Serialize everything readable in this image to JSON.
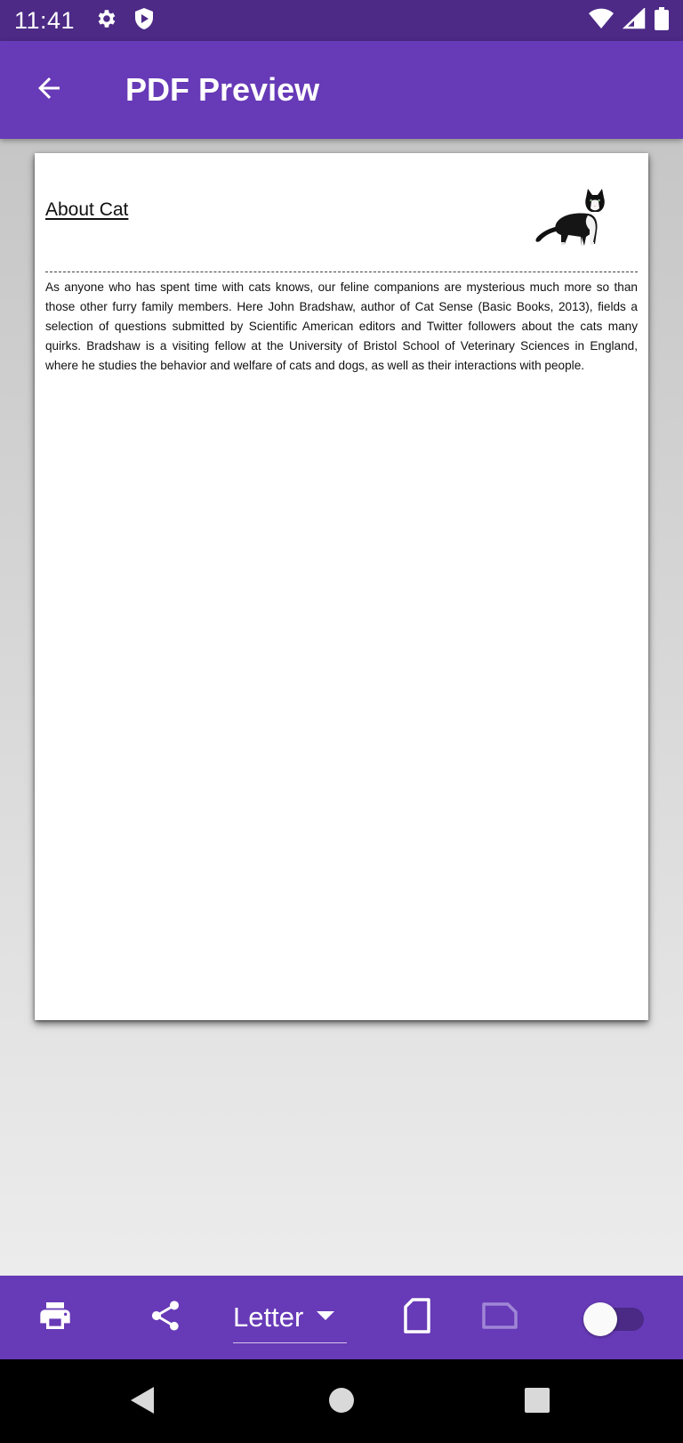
{
  "status_bar": {
    "time": "11:41",
    "icons": [
      "gear-icon",
      "shield-icon",
      "wifi-icon",
      "signal-icon",
      "battery-icon"
    ]
  },
  "app_bar": {
    "title": "PDF Preview",
    "back_icon": "arrow-back-icon"
  },
  "document": {
    "title": "About Cat",
    "image": "cat-photo",
    "body": "As anyone who has spent time with cats knows, our feline companions are mysterious much more so than those other furry family members. Here John Bradshaw, author of Cat Sense (Basic Books, 2013), fields a selection of questions submitted by Scientific American editors and Twitter followers about the cats many quirks. Bradshaw is a visiting fellow at the University of Bristol School of Veterinary Sciences in England, where he studies the behavior and welfare of cats and dogs, as well as their interactions with people."
  },
  "bottom_bar": {
    "print_icon": "print-icon",
    "share_icon": "share-icon",
    "page_size": "Letter",
    "dropdown_icon": "arrow-drop-down-icon",
    "portrait_icon": "portrait-page-icon",
    "landscape_icon": "landscape-page-icon",
    "toggle_on": false
  },
  "nav_bar": {
    "icons": [
      "back-triangle-icon",
      "home-circle-icon",
      "recents-square-icon"
    ]
  },
  "colors": {
    "status_bar": "#4c2a86",
    "primary": "#673ab7",
    "nav_bar": "#000000"
  }
}
